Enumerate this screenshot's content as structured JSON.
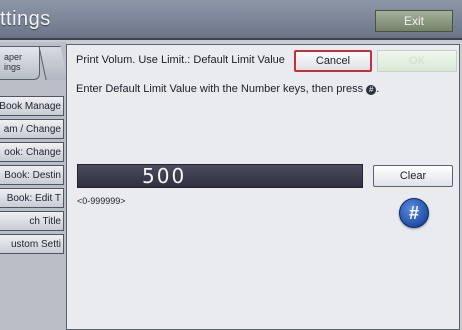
{
  "header": {
    "title": "ttings",
    "exit_label": "Exit"
  },
  "sidebar": {
    "tab_label": "aper\nings",
    "items": [
      {
        "label": "Book Manage"
      },
      {
        "label": "am / Change"
      },
      {
        "label": "ook: Change"
      },
      {
        "label": "Book: Destin"
      },
      {
        "label": "Book: Edit T"
      },
      {
        "label": "ch Title"
      },
      {
        "label": "ustom Setti"
      }
    ]
  },
  "dialog": {
    "prompt": "Print Volum. Use Limit.: Default Limit Value",
    "cancel_label": "Cancel",
    "ok_label": "OK",
    "instruction": "Enter Default Limit Value with the Number keys, then press",
    "instruction_end": ".",
    "instruction_key": "#",
    "value": "500",
    "range": "<0-999999>",
    "clear_label": "Clear",
    "hash_label": "#"
  },
  "colors": {
    "titlebar": "#6b7588",
    "cancel_border": "#c4303a",
    "hash_button": "#1f4fa8",
    "display_bg": "#2e3040"
  }
}
